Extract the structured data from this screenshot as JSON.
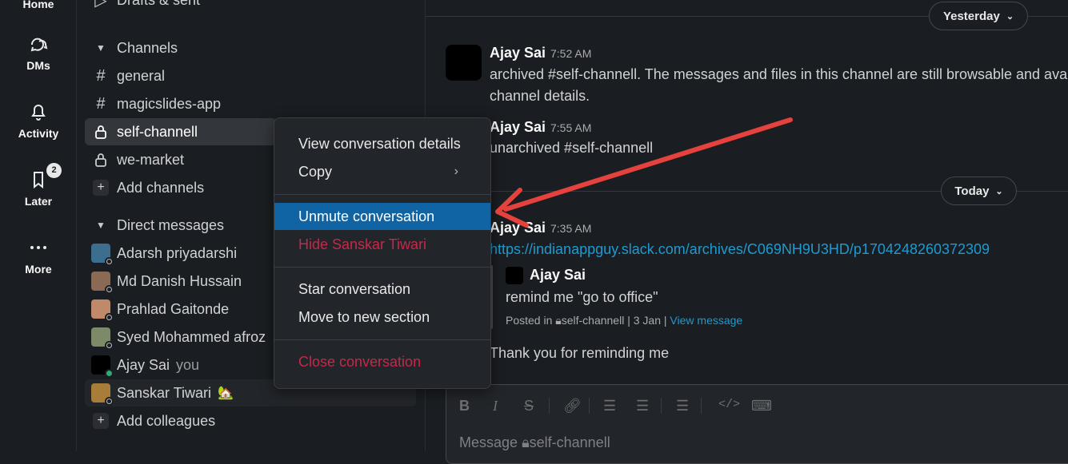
{
  "rail": {
    "home": "Home",
    "dms": "DMs",
    "activity": "Activity",
    "later": "Later",
    "later_badge": "2",
    "more": "More"
  },
  "sidebar": {
    "drafts": "Drafts & sent",
    "channels_header": "Channels",
    "channels": [
      "general",
      "magicslides-app",
      "self-channell",
      "we-market"
    ],
    "add_channels": "Add channels",
    "dm_header": "Direct messages",
    "dms": [
      "Adarsh priyadarshi",
      "Md Danish Hussain",
      "Prahlad Gaitonde",
      "Syed Mohammed afroz",
      "Ajay Sai",
      "Sanskar Tiwari"
    ],
    "you_label": "you",
    "add_colleagues": "Add colleagues"
  },
  "main": {
    "date_yesterday": "Yesterday",
    "date_today": "Today",
    "msg1": {
      "name": "Ajay Sai",
      "time": "7:52 AM",
      "line1": "archived #self-channell. The messages and files in this channel are still browsable and ava",
      "line2": "channel details."
    },
    "msg2": {
      "name": "Ajay Sai",
      "time": "7:55 AM",
      "text": "unarchived #self-channell"
    },
    "msg3": {
      "name": "Ajay Sai",
      "time": "7:35 AM",
      "link": "https://indianappguy.slack.com/archives/C069NH9U3HD/p1704248260372309"
    },
    "quote": {
      "name": "Ajay Sai",
      "text": "remind me \"go to office\"",
      "posted_in": "Posted in",
      "channel": "self-channell",
      "date": "3 Jan",
      "view": "View message"
    },
    "msg4": "Thank you for reminding me",
    "composer_placeholder": "Message",
    "composer_channel": "self-channell"
  },
  "context_menu": {
    "view_details": "View conversation details",
    "copy": "Copy",
    "unmute": "Unmute conversation",
    "hide": "Hide Sanskar Tiwari",
    "star": "Star conversation",
    "move": "Move to new section",
    "close": "Close conversation"
  },
  "colors": {
    "highlight": "#1164a3",
    "danger": "#c5294a",
    "link": "#1d9bd1",
    "arrow": "#e5423e"
  }
}
